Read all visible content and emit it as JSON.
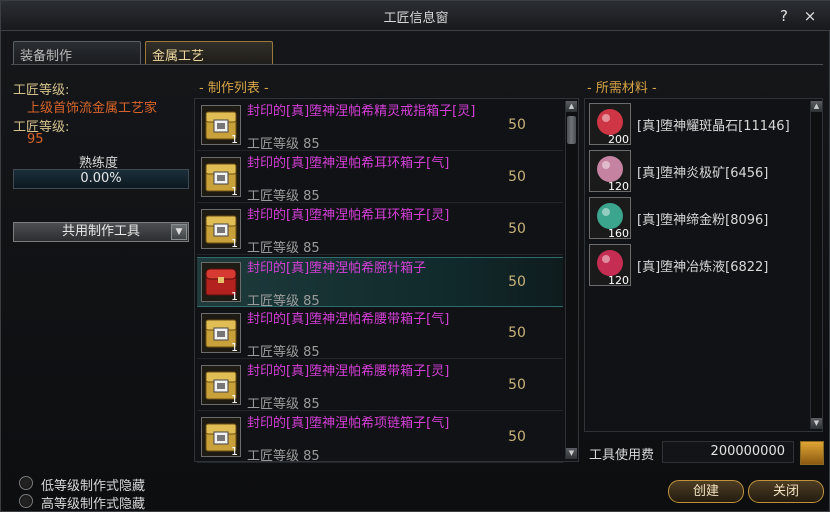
{
  "window": {
    "title": "工匠信息窗",
    "help_icon": "?",
    "close_icon": "×"
  },
  "tabs": [
    {
      "label": "装备制作",
      "active": false
    },
    {
      "label": "金属工艺",
      "active": true
    }
  ],
  "craftsman": {
    "level_label_1": "工匠等级:",
    "title": "上级首饰流金属工艺家",
    "level_label_2": "工匠等级:",
    "level": "95",
    "proficiency_label": "熟练度",
    "proficiency": "0.00%",
    "tool_dropdown": "共用制作工具"
  },
  "craft_list": {
    "header": "- 制作列表 -",
    "level_prefix": "工匠等级",
    "items": [
      {
        "name": "封印的[真]堕神涅帕希精灵戒指箱子[灵]",
        "level": "85",
        "count": "50",
        "icon": "gold-chest-icon",
        "icon_count": "1",
        "selected": false
      },
      {
        "name": "封印的[真]堕神涅帕希耳环箱子[气]",
        "level": "85",
        "count": "50",
        "icon": "gold-chest-icon",
        "icon_count": "1",
        "selected": false
      },
      {
        "name": "封印的[真]堕神涅帕希耳环箱子[灵]",
        "level": "85",
        "count": "50",
        "icon": "gold-chest-icon",
        "icon_count": "1",
        "selected": false
      },
      {
        "name": "封印的[真]堕神涅帕希腕针箱子",
        "level": "85",
        "count": "50",
        "icon": "red-chest-icon",
        "icon_count": "1",
        "selected": true
      },
      {
        "name": "封印的[真]堕神涅帕希腰带箱子[气]",
        "level": "85",
        "count": "50",
        "icon": "gold-chest-icon",
        "icon_count": "1",
        "selected": false
      },
      {
        "name": "封印的[真]堕神涅帕希腰带箱子[灵]",
        "level": "85",
        "count": "50",
        "icon": "gold-chest-icon",
        "icon_count": "1",
        "selected": false
      },
      {
        "name": "封印的[真]堕神涅帕希项链箱子[气]",
        "level": "85",
        "count": "50",
        "icon": "gold-chest-icon",
        "icon_count": "1",
        "selected": false
      }
    ]
  },
  "materials": {
    "header": "- 所需材料 -",
    "items": [
      {
        "name": "[真]堕神耀斑晶石[11146]",
        "count": "200",
        "icon": "red-crystal-icon",
        "color": "#e23a4a"
      },
      {
        "name": "[真]堕神炎极矿[6456]",
        "count": "120",
        "icon": "pink-ore-icon",
        "color": "#d98fb0"
      },
      {
        "name": "[真]堕神缔金粉[8096]",
        "count": "160",
        "icon": "green-powder-icon",
        "color": "#3fb59a"
      },
      {
        "name": "[真]堕神冶炼液[6822]",
        "count": "120",
        "icon": "red-potion-icon",
        "color": "#d8305a"
      }
    ]
  },
  "fee": {
    "label": "工具使用费",
    "value": "200000000"
  },
  "options": [
    {
      "label": "低等级制作式隐藏"
    },
    {
      "label": "高等级制作式隐藏"
    }
  ],
  "buttons": {
    "create": "创建",
    "close": "关闭"
  }
}
